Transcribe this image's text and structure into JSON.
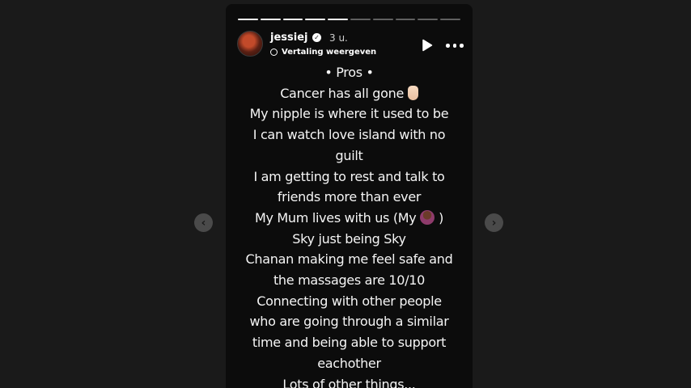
{
  "story": {
    "progress": {
      "segments_total": 10,
      "segments_done": 5
    },
    "header": {
      "username": "jessiej",
      "verified": true,
      "time_ago": "3 u.",
      "translate_label": "Vertaling weergeven"
    },
    "text_lines": [
      "• Pros •",
      "Cancer has all gone",
      "My nipple is where it used to be",
      "I can watch love island with no",
      "guilt",
      "I am getting to rest and talk to",
      "friends more than ever",
      "My Mum lives with us (My",
      "Sky just being Sky",
      "Chanan making me feel safe and",
      "the massages are 10/10",
      "Connecting with other people",
      "who are going through a similar",
      "time and being able to support",
      "eachother",
      "Lots of other things..."
    ],
    "line_suffixes": {
      "line7_after_emoji": ")"
    },
    "emojis": {
      "line1": "crossed-fingers-emoji",
      "line7": "woman-emoji"
    }
  },
  "navigation": {
    "prev_icon": "chevron-left-icon",
    "next_icon": "chevron-right-icon"
  },
  "colors": {
    "background": "#1a1a1a",
    "story_background": "#0c0c0c",
    "text": "#f5f5f5",
    "nav_button": "#4a4a4a"
  }
}
